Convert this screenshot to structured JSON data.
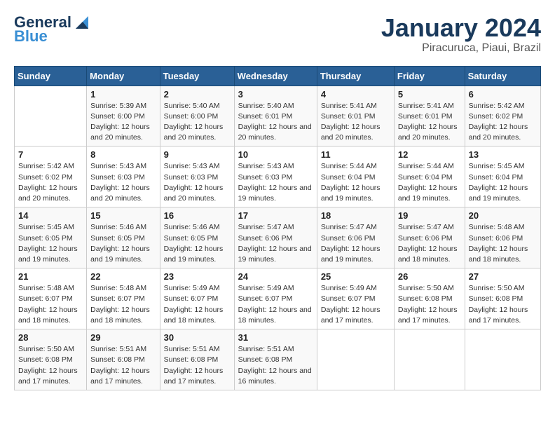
{
  "logo": {
    "general": "General",
    "blue": "Blue"
  },
  "title": "January 2024",
  "location": "Piracuruca, Piaui, Brazil",
  "days_of_week": [
    "Sunday",
    "Monday",
    "Tuesday",
    "Wednesday",
    "Thursday",
    "Friday",
    "Saturday"
  ],
  "weeks": [
    [
      {
        "day": "",
        "info": ""
      },
      {
        "day": "1",
        "info": "Sunrise: 5:39 AM\nSunset: 6:00 PM\nDaylight: 12 hours and 20 minutes."
      },
      {
        "day": "2",
        "info": "Sunrise: 5:40 AM\nSunset: 6:00 PM\nDaylight: 12 hours and 20 minutes."
      },
      {
        "day": "3",
        "info": "Sunrise: 5:40 AM\nSunset: 6:01 PM\nDaylight: 12 hours and 20 minutes."
      },
      {
        "day": "4",
        "info": "Sunrise: 5:41 AM\nSunset: 6:01 PM\nDaylight: 12 hours and 20 minutes."
      },
      {
        "day": "5",
        "info": "Sunrise: 5:41 AM\nSunset: 6:01 PM\nDaylight: 12 hours and 20 minutes."
      },
      {
        "day": "6",
        "info": "Sunrise: 5:42 AM\nSunset: 6:02 PM\nDaylight: 12 hours and 20 minutes."
      }
    ],
    [
      {
        "day": "7",
        "info": "Sunrise: 5:42 AM\nSunset: 6:02 PM\nDaylight: 12 hours and 20 minutes."
      },
      {
        "day": "8",
        "info": "Sunrise: 5:43 AM\nSunset: 6:03 PM\nDaylight: 12 hours and 20 minutes."
      },
      {
        "day": "9",
        "info": "Sunrise: 5:43 AM\nSunset: 6:03 PM\nDaylight: 12 hours and 20 minutes."
      },
      {
        "day": "10",
        "info": "Sunrise: 5:43 AM\nSunset: 6:03 PM\nDaylight: 12 hours and 19 minutes."
      },
      {
        "day": "11",
        "info": "Sunrise: 5:44 AM\nSunset: 6:04 PM\nDaylight: 12 hours and 19 minutes."
      },
      {
        "day": "12",
        "info": "Sunrise: 5:44 AM\nSunset: 6:04 PM\nDaylight: 12 hours and 19 minutes."
      },
      {
        "day": "13",
        "info": "Sunrise: 5:45 AM\nSunset: 6:04 PM\nDaylight: 12 hours and 19 minutes."
      }
    ],
    [
      {
        "day": "14",
        "info": "Sunrise: 5:45 AM\nSunset: 6:05 PM\nDaylight: 12 hours and 19 minutes."
      },
      {
        "day": "15",
        "info": "Sunrise: 5:46 AM\nSunset: 6:05 PM\nDaylight: 12 hours and 19 minutes."
      },
      {
        "day": "16",
        "info": "Sunrise: 5:46 AM\nSunset: 6:05 PM\nDaylight: 12 hours and 19 minutes."
      },
      {
        "day": "17",
        "info": "Sunrise: 5:47 AM\nSunset: 6:06 PM\nDaylight: 12 hours and 19 minutes."
      },
      {
        "day": "18",
        "info": "Sunrise: 5:47 AM\nSunset: 6:06 PM\nDaylight: 12 hours and 19 minutes."
      },
      {
        "day": "19",
        "info": "Sunrise: 5:47 AM\nSunset: 6:06 PM\nDaylight: 12 hours and 18 minutes."
      },
      {
        "day": "20",
        "info": "Sunrise: 5:48 AM\nSunset: 6:06 PM\nDaylight: 12 hours and 18 minutes."
      }
    ],
    [
      {
        "day": "21",
        "info": "Sunrise: 5:48 AM\nSunset: 6:07 PM\nDaylight: 12 hours and 18 minutes."
      },
      {
        "day": "22",
        "info": "Sunrise: 5:48 AM\nSunset: 6:07 PM\nDaylight: 12 hours and 18 minutes."
      },
      {
        "day": "23",
        "info": "Sunrise: 5:49 AM\nSunset: 6:07 PM\nDaylight: 12 hours and 18 minutes."
      },
      {
        "day": "24",
        "info": "Sunrise: 5:49 AM\nSunset: 6:07 PM\nDaylight: 12 hours and 18 minutes."
      },
      {
        "day": "25",
        "info": "Sunrise: 5:49 AM\nSunset: 6:07 PM\nDaylight: 12 hours and 17 minutes."
      },
      {
        "day": "26",
        "info": "Sunrise: 5:50 AM\nSunset: 6:08 PM\nDaylight: 12 hours and 17 minutes."
      },
      {
        "day": "27",
        "info": "Sunrise: 5:50 AM\nSunset: 6:08 PM\nDaylight: 12 hours and 17 minutes."
      }
    ],
    [
      {
        "day": "28",
        "info": "Sunrise: 5:50 AM\nSunset: 6:08 PM\nDaylight: 12 hours and 17 minutes."
      },
      {
        "day": "29",
        "info": "Sunrise: 5:51 AM\nSunset: 6:08 PM\nDaylight: 12 hours and 17 minutes."
      },
      {
        "day": "30",
        "info": "Sunrise: 5:51 AM\nSunset: 6:08 PM\nDaylight: 12 hours and 17 minutes."
      },
      {
        "day": "31",
        "info": "Sunrise: 5:51 AM\nSunset: 6:08 PM\nDaylight: 12 hours and 16 minutes."
      },
      {
        "day": "",
        "info": ""
      },
      {
        "day": "",
        "info": ""
      },
      {
        "day": "",
        "info": ""
      }
    ]
  ]
}
